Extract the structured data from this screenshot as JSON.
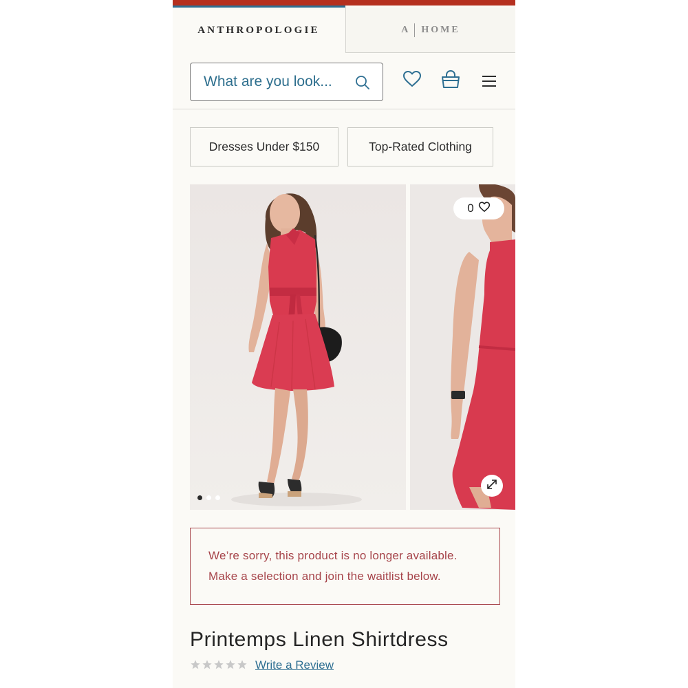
{
  "header": {
    "tabs": [
      {
        "label": "ANTHROPOLOGIE",
        "active": true
      },
      {
        "prefix": "A",
        "label": "HOME",
        "active": false
      }
    ],
    "accent_red": "#b5301f",
    "accent_blue": "#2e6f92"
  },
  "search": {
    "placeholder": "What are you look...",
    "icon": "search-icon"
  },
  "header_icons": [
    "heart-icon",
    "shopping-bag-icon",
    "hamburger-menu-icon"
  ],
  "quick_links": [
    "Dresses Under $150",
    "Top-Rated Clothing"
  ],
  "gallery": {
    "images": [
      {
        "description": "model-front-red-dress"
      },
      {
        "description": "model-side-red-dress"
      }
    ],
    "dot_count": 3,
    "active_dot": 0,
    "like_count": "0"
  },
  "notice": {
    "line1": "We’re sorry, this product is no longer available.",
    "line2": "Make a selection and join the waitlist below.",
    "color": "#a6444a"
  },
  "product": {
    "title": "Printemps Linen Shirtdress",
    "rating": 0,
    "rating_max": 5,
    "review_link": "Write a Review"
  }
}
